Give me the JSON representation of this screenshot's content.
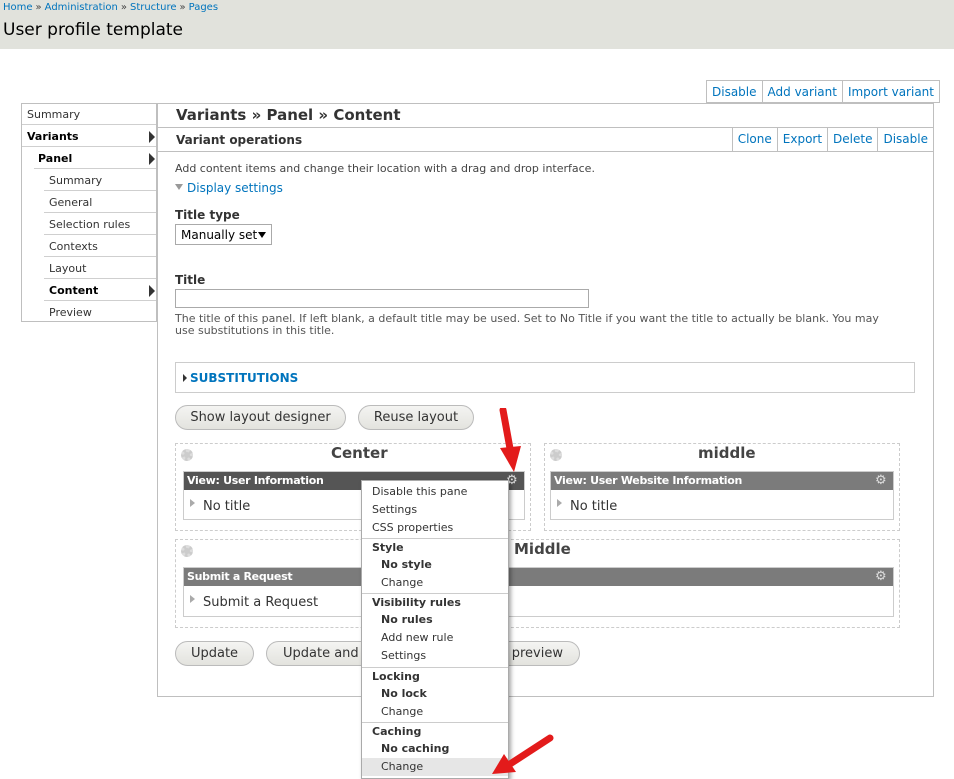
{
  "breadcrumb": [
    "Home",
    "Administration",
    "Structure",
    "Pages"
  ],
  "breadcrumb_separator": "»",
  "page_title": "User profile template",
  "top_actions": [
    "Disable",
    "Add variant",
    "Import variant"
  ],
  "nav": {
    "items": [
      {
        "label": "Summary"
      },
      {
        "label": "Variants"
      },
      {
        "label": "Panel"
      },
      {
        "label": "Summary"
      },
      {
        "label": "General"
      },
      {
        "label": "Selection rules"
      },
      {
        "label": "Contexts"
      },
      {
        "label": "Layout"
      },
      {
        "label": "Content"
      },
      {
        "label": "Preview"
      }
    ]
  },
  "main": {
    "heading": "Variants » Panel » Content",
    "variant_ops_label": "Variant operations",
    "variant_ops": [
      "Clone",
      "Export",
      "Delete",
      "Disable"
    ],
    "intro": "Add content items and change their location with a drag and drop interface.",
    "display_settings": "Display settings",
    "title_type_label": "Title type",
    "title_type_value": "Manually set",
    "title_label": "Title",
    "title_value": "",
    "title_description": "The title of this panel. If left blank, a default title may be used. Set to No Title if you want the title to actually be blank. You may use substitutions in this title.",
    "substitutions": "SUBSTITUTIONS",
    "buttons": {
      "show_layout_designer": "Show layout designer",
      "reuse_layout": "Reuse layout",
      "update": "Update",
      "update_and": "Update and",
      "preview": "preview"
    }
  },
  "regions": {
    "center": {
      "title": "Center",
      "pane_title": "View: User Information",
      "pane_body": "No title"
    },
    "middle": {
      "title": "middle",
      "pane_title": "View: User Website Information",
      "pane_body": "No title"
    },
    "bottom": {
      "title": "Middle",
      "pane_title": "Submit a Request",
      "pane_body": "Submit a Request"
    }
  },
  "gear_menu": {
    "disable_pane": "Disable this pane",
    "settings": "Settings",
    "css_properties": "CSS properties",
    "style_header": "Style",
    "style_value": "No style",
    "style_change": "Change",
    "visibility_header": "Visibility rules",
    "visibility_value": "No rules",
    "visibility_add": "Add new rule",
    "visibility_settings": "Settings",
    "locking_header": "Locking",
    "locking_value": "No lock",
    "locking_change": "Change",
    "caching_header": "Caching",
    "caching_value": "No caching",
    "caching_change": "Change"
  },
  "colors": {
    "header_bg": "#e1e2dc",
    "link": "#0074bd",
    "pane_bar": "#7b7b7b",
    "arrow": "#e31b1b"
  }
}
